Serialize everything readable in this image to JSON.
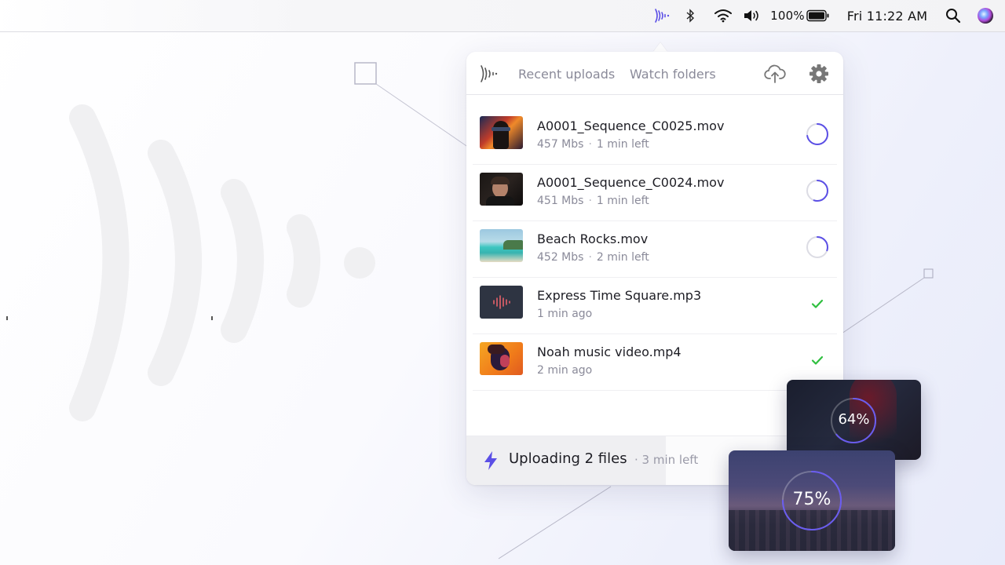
{
  "menubar": {
    "battery_percent": "100%",
    "clock": "Fri 11:22 AM",
    "icons": [
      "app-logo-icon",
      "bluetooth-icon",
      "wifi-icon",
      "volume-icon",
      "battery-icon",
      "search-icon",
      "siri-icon"
    ]
  },
  "popup": {
    "tabs": [
      {
        "label": "Recent uploads",
        "active": true
      },
      {
        "label": "Watch folders",
        "active": false
      }
    ],
    "actions": [
      "upload-cloud-icon",
      "gear-icon"
    ],
    "uploads": [
      {
        "name": "A0001_Sequence_C0025.mov",
        "size": "457 Mbs",
        "time": "1 min left",
        "status": "uploading",
        "progress": 0.72
      },
      {
        "name": "A0001_Sequence_C0024.mov",
        "size": "451 Mbs",
        "time": "1 min left",
        "status": "uploading",
        "progress": 0.55
      },
      {
        "name": "Beach Rocks.mov",
        "size": "452 Mbs",
        "time": "2 min left",
        "status": "uploading",
        "progress": 0.3
      },
      {
        "name": "Express Time Square.mp3",
        "time": "1 min ago",
        "status": "done"
      },
      {
        "name": "Noah music video.mp4",
        "time": "2 min ago",
        "status": "done"
      }
    ],
    "footer": {
      "title": "Uploading 2 files",
      "subtitle": "· 3 min left",
      "progress": 0.53
    }
  },
  "cards": [
    {
      "percent_label": "64%",
      "progress": 0.64
    },
    {
      "percent_label": "75%",
      "progress": 0.75
    }
  ],
  "colors": {
    "accent": "#5b4fe6",
    "success": "#2fbf3f",
    "muted": "#8a8a99"
  }
}
